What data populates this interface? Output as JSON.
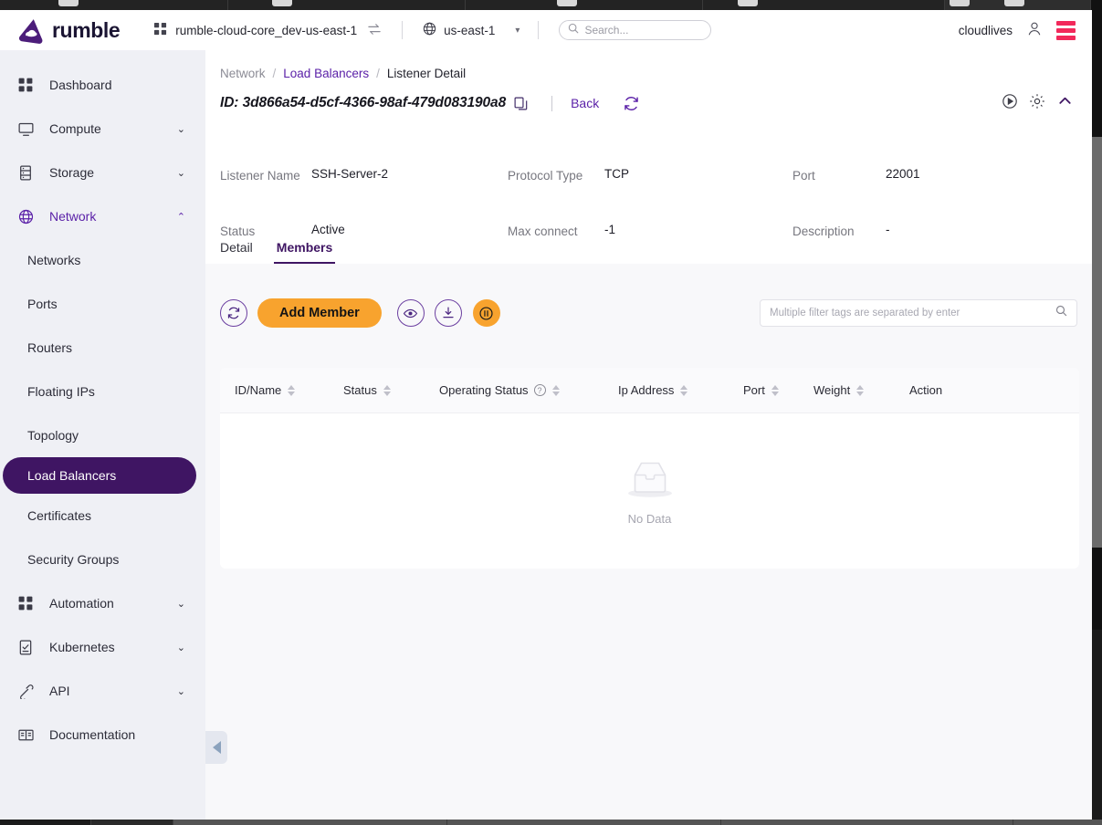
{
  "topbar": {
    "logo_text": "rumble",
    "project": "rumble-cloud-core_dev-us-east-1",
    "region": "us-east-1",
    "search_placeholder": "Search...",
    "user": "cloudlives",
    "accent_purple": "#3f1563",
    "accent_orange": "#f8a32e",
    "accent_pink": "#f2295b"
  },
  "sidebar": {
    "items": [
      {
        "label": "Dashboard",
        "icon": "grid-icon",
        "expandable": false
      },
      {
        "label": "Compute",
        "icon": "monitor-icon",
        "expandable": true,
        "caret": "⌄"
      },
      {
        "label": "Storage",
        "icon": "database-icon",
        "expandable": true,
        "caret": "⌄"
      },
      {
        "label": "Network",
        "icon": "globe-icon",
        "expandable": true,
        "caret": "⌃",
        "active": true
      }
    ],
    "network_children": [
      {
        "label": "Networks"
      },
      {
        "label": "Ports"
      },
      {
        "label": "Routers"
      },
      {
        "label": "Floating IPs"
      },
      {
        "label": "Topology"
      },
      {
        "label": "Load Balancers",
        "selected": true
      },
      {
        "label": "Certificates"
      },
      {
        "label": "Security Groups"
      }
    ],
    "items_bottom": [
      {
        "label": "Automation",
        "icon": "grid-icon",
        "expandable": true,
        "caret": "⌄"
      },
      {
        "label": "Kubernetes",
        "icon": "kubernetes-icon",
        "expandable": true,
        "caret": "⌄"
      },
      {
        "label": "API",
        "icon": "api-icon",
        "expandable": true,
        "caret": "⌄"
      },
      {
        "label": "Documentation",
        "icon": "book-icon",
        "expandable": false
      }
    ]
  },
  "breadcrumb": {
    "root": "Network",
    "sep": "/",
    "link": "Load Balancers",
    "current": "Listener Detail"
  },
  "header": {
    "id_text": "ID: 3d866a54-d5cf-4366-98af-479d083190a8",
    "back_label": "Back"
  },
  "fields": [
    {
      "key": "Listener Name",
      "value": "SSH-Server-2"
    },
    {
      "key": "Protocol Type",
      "value": "TCP"
    },
    {
      "key": "Port",
      "value": "22001"
    },
    {
      "key": "Status",
      "value": "Active"
    },
    {
      "key": "Max connect",
      "value": "-1"
    },
    {
      "key": "Description",
      "value": "-"
    }
  ],
  "tabs": [
    {
      "label": "Detail",
      "active": false
    },
    {
      "label": "Members",
      "active": true
    }
  ],
  "toolbar": {
    "add_label": "Add Member",
    "filter_placeholder": "Multiple filter tags are separated by enter"
  },
  "table": {
    "columns": [
      {
        "label": "ID/Name",
        "sortable": true,
        "help": false
      },
      {
        "label": "Status",
        "sortable": true,
        "help": false
      },
      {
        "label": "Operating Status",
        "sortable": true,
        "help": true
      },
      {
        "label": "Ip Address",
        "sortable": true,
        "help": false
      },
      {
        "label": "Port",
        "sortable": true,
        "help": false
      },
      {
        "label": "Weight",
        "sortable": true,
        "help": false
      },
      {
        "label": "Action",
        "sortable": false,
        "help": false
      }
    ],
    "rows": [],
    "empty_label": "No Data"
  }
}
